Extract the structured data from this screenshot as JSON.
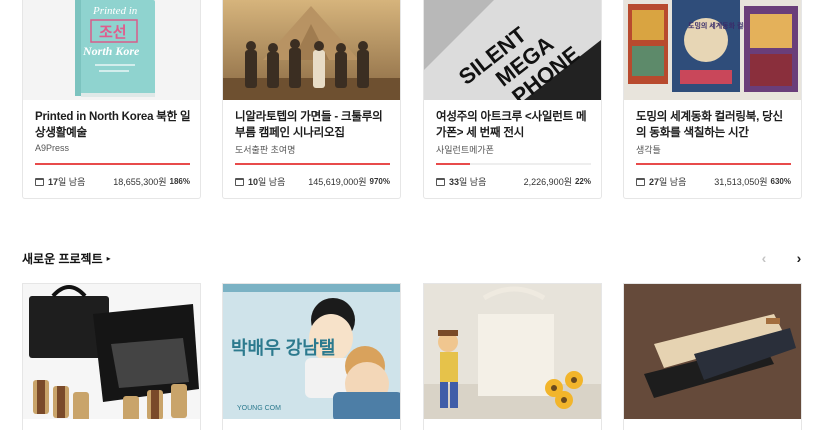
{
  "top_cards": [
    {
      "title": "Printed in North Korea 북한 일상생활예술",
      "creator": "A9Press",
      "days": "17",
      "days_suffix": "일 남음",
      "amount": "18,655,300원",
      "percent": "186%",
      "progress": 1.0
    },
    {
      "title": "니알라토텝의 가면들 - 크툴루의 부름 캠페인 시나리오집",
      "creator": "도서출판 초여명",
      "days": "10",
      "days_suffix": "일 남음",
      "amount": "145,619,000원",
      "percent": "970%",
      "progress": 1.0
    },
    {
      "title": "여성주의 아트크루 <사일런트 메가폰> 세 번째 전시",
      "creator": "사일런트메가폰",
      "days": "33",
      "days_suffix": "일 남음",
      "amount": "2,226,900원",
      "percent": "22%",
      "progress": 0.22
    },
    {
      "title": "도밍의 세계동화 컬러링북, 당신의 동화를 색칠하는 시간",
      "creator": "생각틀",
      "days": "27",
      "days_suffix": "일 남음",
      "amount": "31,513,050원",
      "percent": "630%",
      "progress": 1.0
    }
  ],
  "thumb_text": {
    "book_title": "조선",
    "book_sub": "North Kore",
    "book_top": "Printed in",
    "megaphone_1": "SILENT",
    "megaphone_2": "MEGA",
    "megaphone_3": "PHONE",
    "coloring_title": "도밍의 세계동화 컬러링북",
    "webtoon_title": "박배우 강남탤",
    "webtoon_logo": "YOUNG COM"
  },
  "section": {
    "title": "새로운 프로젝트",
    "arrow": "▸"
  },
  "nav": {
    "prev": "‹",
    "next": "›"
  },
  "colors": {
    "accent": "#e84b4b",
    "progress_track": "#eeeeee"
  }
}
